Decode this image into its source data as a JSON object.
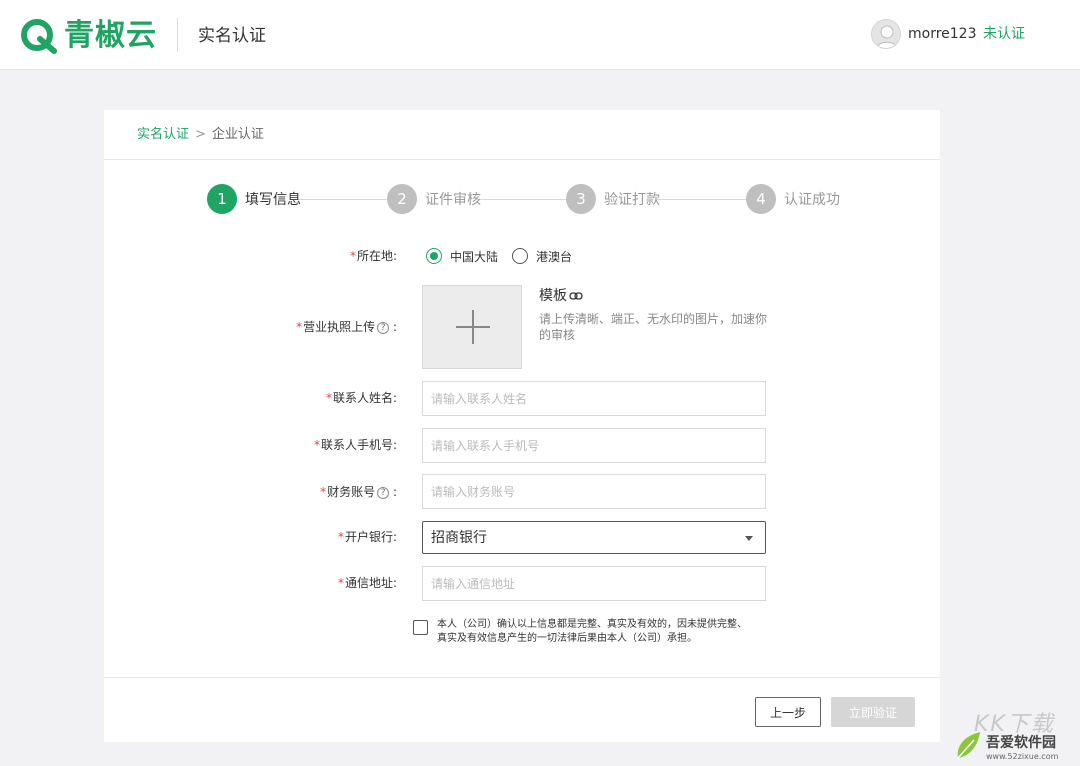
{
  "header": {
    "logo_text": "青椒云",
    "title": "实名认证",
    "username": "morre123",
    "status": "未认证"
  },
  "breadcrumb": {
    "items": [
      "实名认证",
      "企业认证"
    ],
    "separator": ">"
  },
  "steps": [
    {
      "number": "1",
      "label": "填写信息",
      "active": true
    },
    {
      "number": "2",
      "label": "证件审核",
      "active": false
    },
    {
      "number": "3",
      "label": "验证打款",
      "active": false
    },
    {
      "number": "4",
      "label": "认证成功",
      "active": false
    }
  ],
  "form": {
    "location": {
      "label": "所在地:",
      "options": [
        "中国大陆",
        "港澳台"
      ],
      "selected": "中国大陆"
    },
    "license": {
      "label": "营业执照上传",
      "help": "?",
      "template_link": "模板",
      "hint": "请上传清晰、端正、无水印的图片，加速你的审核"
    },
    "contact_name": {
      "label": "联系人姓名:",
      "placeholder": "请输入联系人姓名",
      "value": ""
    },
    "contact_phone": {
      "label": "联系人手机号:",
      "placeholder": "请输入联系人手机号",
      "value": ""
    },
    "finance_account": {
      "label": "财务账号",
      "help": "?",
      "placeholder": "请输入财务账号",
      "value": ""
    },
    "bank": {
      "label": "开户银行:",
      "value": "招商银行"
    },
    "address": {
      "label": "通信地址:",
      "placeholder": "请输入通信地址",
      "value": ""
    },
    "agreement": {
      "checked": false,
      "text": "本人（公司）确认以上信息都是完整、真实及有效的，因未提供完整、真实及有效信息产生的一切法律后果由本人（公司）承担。"
    }
  },
  "buttons": {
    "prev": "上一步",
    "submit": "立即验证"
  },
  "watermark": {
    "big": "KK下载",
    "name": "吾爱软件园",
    "url": "www.52zixue.com"
  },
  "colors": {
    "accent": "#1fa463",
    "required": "#e54545",
    "disabled_button": "#d6d6d6"
  }
}
